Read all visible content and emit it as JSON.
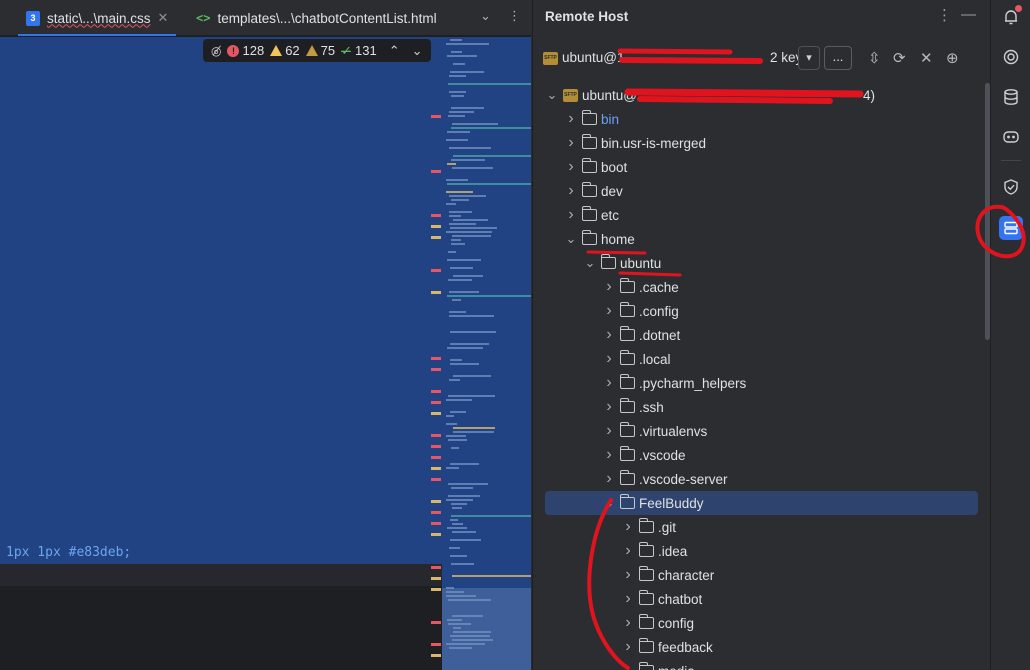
{
  "editor": {
    "tabs": [
      {
        "label": "static\\...\\main.css",
        "icon": "css-file-icon",
        "active": true,
        "close": "✕"
      },
      {
        "label": "templates\\...\\chatbotContentList.html",
        "icon": "html-file-icon",
        "active": false
      }
    ],
    "inspections": {
      "errors": "128",
      "warnings": "62",
      "weak_warnings": "75",
      "typos": "131"
    },
    "code_line": "1px 1px #e83deb;"
  },
  "remote": {
    "title": "Remote Host",
    "connection": {
      "name": "ubuntu@1",
      "suffix": "2 key",
      "more_label": "...",
      "dropdown": "▾"
    },
    "tree": [
      {
        "label": "ubuntu@",
        "tail": "4)",
        "level": 0,
        "expanded": true,
        "type": "sftp"
      },
      {
        "label": "bin",
        "level": 1,
        "expanded": false,
        "blue": true
      },
      {
        "label": "bin.usr-is-merged",
        "level": 1,
        "expanded": false
      },
      {
        "label": "boot",
        "level": 1,
        "expanded": false
      },
      {
        "label": "dev",
        "level": 1,
        "expanded": false
      },
      {
        "label": "etc",
        "level": 1,
        "expanded": false
      },
      {
        "label": "home",
        "level": 1,
        "expanded": true
      },
      {
        "label": "ubuntu",
        "level": 2,
        "expanded": true
      },
      {
        "label": ".cache",
        "level": 3,
        "expanded": false
      },
      {
        "label": ".config",
        "level": 3,
        "expanded": false
      },
      {
        "label": ".dotnet",
        "level": 3,
        "expanded": false
      },
      {
        "label": ".local",
        "level": 3,
        "expanded": false
      },
      {
        "label": ".pycharm_helpers",
        "level": 3,
        "expanded": false
      },
      {
        "label": ".ssh",
        "level": 3,
        "expanded": false
      },
      {
        "label": ".virtualenvs",
        "level": 3,
        "expanded": false
      },
      {
        "label": ".vscode",
        "level": 3,
        "expanded": false
      },
      {
        "label": ".vscode-server",
        "level": 3,
        "expanded": false
      },
      {
        "label": "FeelBuddy",
        "level": 3,
        "expanded": true,
        "selected": true
      },
      {
        "label": ".git",
        "level": 4,
        "expanded": false
      },
      {
        "label": ".idea",
        "level": 4,
        "expanded": false
      },
      {
        "label": "character",
        "level": 4,
        "expanded": false
      },
      {
        "label": "chatbot",
        "level": 4,
        "expanded": false
      },
      {
        "label": "config",
        "level": 4,
        "expanded": false
      },
      {
        "label": "feedback",
        "level": 4,
        "expanded": false
      },
      {
        "label": "media",
        "level": 4,
        "expanded": false
      }
    ]
  },
  "strip": {
    "icons": [
      "notifications-icon",
      "ai-assistant-icon",
      "database-icon",
      "copilot-icon",
      "security-icon",
      "remote-host-icon"
    ],
    "active": "remote-host-icon"
  },
  "colors": {
    "accent": "#3574f0",
    "selection": "#2e436e",
    "error": "#e55765",
    "warning": "#f2c55c",
    "annotation": "#e0141e"
  }
}
